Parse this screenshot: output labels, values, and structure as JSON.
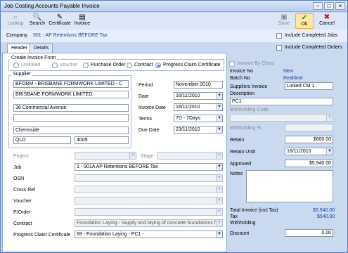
{
  "window": {
    "title": "Job Costing Accounts Payable Invoice"
  },
  "toolbar": {
    "lookup": "Lookup",
    "search": "Search",
    "certificate": "Certificate",
    "invoice": "Invoice",
    "save": "Save",
    "ok": "Ok",
    "cancel": "Cancel"
  },
  "company": {
    "label": "Company",
    "value": "901 - AP Retentions BEFORE Tax"
  },
  "options": {
    "include_completed_jobs": "Include Completed Jobs",
    "include_completed_orders": "Include Completed Orders"
  },
  "tabs": {
    "header": "Header",
    "details": "Details"
  },
  "create_from": {
    "title": "Create Invoice From",
    "unlinked": "Unlinked",
    "voucher": "Voucher",
    "purchase_order": "Purchase Order",
    "contract": "Contract",
    "progress_claim": "Progress Claim Certificate"
  },
  "supplier": {
    "title": "Supplier",
    "code": "BFORM - BRISBANE FORMWORK LIMITED - C",
    "name": "BRISBANE FORMWORK LIMITED",
    "address1": "36 Commercial Avenue",
    "address2": "",
    "suburb": "Chermside",
    "state": "QLD",
    "postcode": "4005"
  },
  "dates": {
    "period_label": "Period",
    "period": "November 2010",
    "date_label": "Date",
    "date": "16/11/2010",
    "invoice_date_label": "Invoice Date",
    "invoice_date": "16/11/2010",
    "terms_label": "Terms",
    "terms": "7D - 7Days",
    "due_date_label": "Due Date",
    "due_date": "23/11/2010"
  },
  "project": {
    "project_label": "Project",
    "stage_label": "Stage",
    "job_label": "Job",
    "job": "1 - 901A AP Retentions BEFORE Tax",
    "osn_label": "OSN",
    "crossref_label": "Cross Ref",
    "voucher_label": "Voucher",
    "porder_label": "P/Order",
    "contract_label": "Contract",
    "contract": "Foundation Laying - Supply and laying of concrete foundations for",
    "pcc_label": "Progress Claim Certificate",
    "pcc": "69 - Foundation Laying - PC1 -"
  },
  "invoice": {
    "by_class": "Invoice By Class",
    "invoice_no_label": "Invoice No",
    "invoice_no": "New",
    "batch_no_label": "Batch No",
    "batch_no": "Realtime",
    "supplier_invoice_label": "Suppliers Invoice",
    "supplier_invoice": "Linked CM 1",
    "description_label": "Description",
    "description": "PC1",
    "withholding_code_label": "Withholding Code",
    "withholding_pct_label": "Withholding %",
    "retain_label": "Retain",
    "retain": "$600.00",
    "retain_until_label": "Retain Until",
    "retain_until": "16/11/2010",
    "approved_label": "Approved",
    "approved": "$5,940.00",
    "notes_label": "Notes",
    "total_label": "Total Invoice (incl Tax)",
    "total": "$5,940.00",
    "tax_label": "Tax",
    "tax": "$540.00",
    "withholding_label": "Withholding",
    "discount_label": "Discount",
    "discount": "0.00"
  }
}
